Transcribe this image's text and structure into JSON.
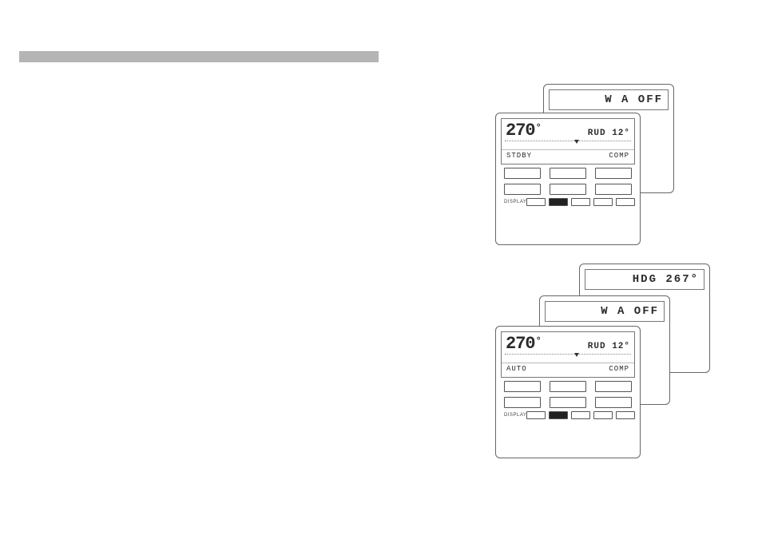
{
  "group1": {
    "back": {
      "banner": "W A OFF"
    },
    "front": {
      "heading_value": "270",
      "rudder_label": "RUD",
      "rudder_value": "12",
      "mode": "STDBY",
      "comp": "COMP",
      "small_caption": "DISPLAY"
    }
  },
  "group2": {
    "back2": {
      "banner": "HDG 267°"
    },
    "back": {
      "banner": "W A OFF"
    },
    "front": {
      "heading_value": "270",
      "rudder_label": "RUD",
      "rudder_value": "12",
      "mode": "AUTO",
      "comp": "COMP",
      "small_caption": "DISPLAY"
    }
  }
}
